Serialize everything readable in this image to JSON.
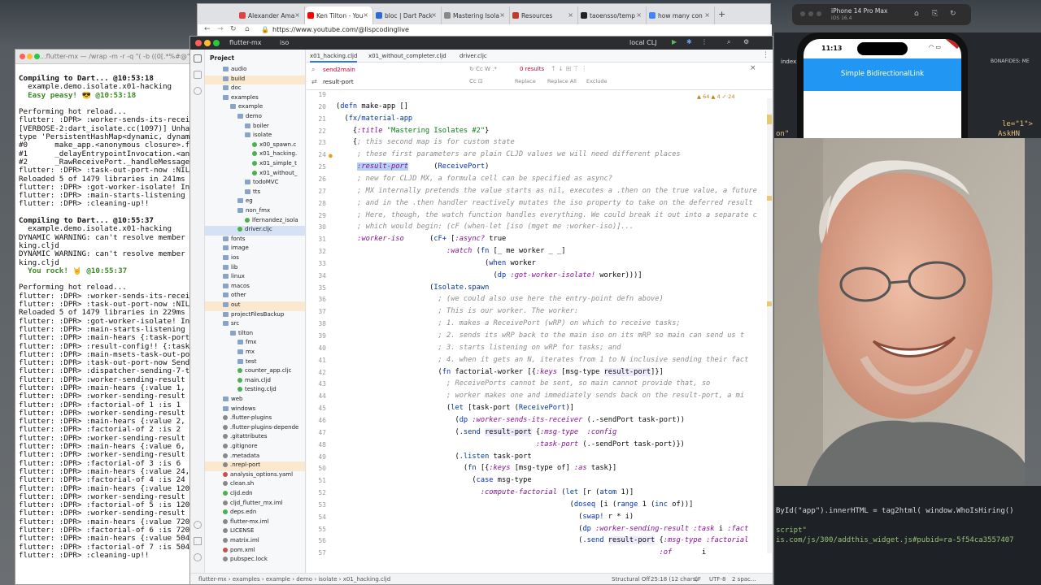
{
  "terminal": {
    "title": "...flutter-mx — /wrap -m -r -q \"( -b ((0[.*%#@\": /usr/local/Ca",
    "lines": [
      {
        "t": "Compiling to Dart... @10:53:18",
        "c": "b"
      },
      {
        "t": "  example.demo.isolate.x01-hacking",
        "c": ""
      },
      {
        "t": "  Easy peasy! 😎 @10:53:18",
        "c": "g"
      },
      {
        "t": "",
        "c": "sp"
      },
      {
        "t": "Performing hot reload...",
        "c": ""
      },
      {
        "t": "flutter: :DPR> :worker-sends-its-receive",
        "c": ""
      },
      {
        "t": "[VERBOSE-2:dart_isolate.cc(1097)] Unhand",
        "c": ""
      },
      {
        "t": "type 'PersistentHashMap<dynamic, dynamic",
        "c": ""
      },
      {
        "t": "#0      make_app.<anonymous closure>.fac",
        "c": ""
      },
      {
        "t": "#1      _delayEntrypointInvocation.<anon",
        "c": ""
      },
      {
        "t": "#2      _RawReceivePort._handleMessage (",
        "c": ""
      },
      {
        "t": "flutter: :DPR> :task-out-port-now :NIL",
        "c": ""
      },
      {
        "t": "Reloaded 5 of 1479 libraries in 241ms (c",
        "c": ""
      },
      {
        "t": "flutter: :DPR> :got-worker-isolate! Inst",
        "c": ""
      },
      {
        "t": "flutter: :DPR> :main-starts-listening",
        "c": ""
      },
      {
        "t": "flutter: :DPR> :cleaning-up!!",
        "c": ""
      },
      {
        "t": "",
        "c": "sp"
      },
      {
        "t": "Compiling to Dart... @10:55:37",
        "c": "b"
      },
      {
        "t": "  example.demo.isolate.x01-hacking",
        "c": ""
      },
      {
        "t": "DYNAMIC WARNING: can't resolve member se",
        "c": ""
      },
      {
        "t": "king.cljd",
        "c": ""
      },
      {
        "t": "DYNAMIC WARNING: can't resolve member se",
        "c": ""
      },
      {
        "t": "king.cljd",
        "c": ""
      },
      {
        "t": "  You rock! 🤘 @10:55:37",
        "c": "g"
      },
      {
        "t": "",
        "c": "sp"
      },
      {
        "t": "Performing hot reload...",
        "c": ""
      },
      {
        "t": "flutter: :DPR> :worker-sends-its-receive",
        "c": ""
      },
      {
        "t": "flutter: :DPR> :task-out-port-now :NIL",
        "c": ""
      },
      {
        "t": "Reloaded 5 of 1479 libraries in 229ms (c",
        "c": ""
      },
      {
        "t": "flutter: :DPR> :got-worker-isolate! Inst",
        "c": ""
      },
      {
        "t": "flutter: :DPR> :main-starts-listening",
        "c": ""
      },
      {
        "t": "flutter: :DPR> :main-hears {:task-port S",
        "c": ""
      },
      {
        "t": "flutter: :DPR> :result-config!! {:task-p",
        "c": ""
      },
      {
        "t": "flutter: :DPR> :main-msets-task-out-port",
        "c": ""
      },
      {
        "t": "flutter: :DPR> :task-out-port-now SendPo",
        "c": ""
      },
      {
        "t": "flutter: :DPR> :dispatcher-sending-7-to-",
        "c": ""
      },
      {
        "t": "flutter: :DPR> :worker-sending-result :t",
        "c": ""
      },
      {
        "t": "flutter: :DPR> :main-hears {:value 1, :m",
        "c": ""
      },
      {
        "t": "flutter: :DPR> :worker-sending-result :t",
        "c": ""
      },
      {
        "t": "flutter: :DPR> :factorial-of 1 :is 1",
        "c": ""
      },
      {
        "t": "flutter: :DPR> :worker-sending-result :t",
        "c": ""
      },
      {
        "t": "flutter: :DPR> :main-hears {:value 2, :m",
        "c": ""
      },
      {
        "t": "flutter: :DPR> :factorial-of 2 :is 2",
        "c": ""
      },
      {
        "t": "flutter: :DPR> :worker-sending-result :t",
        "c": ""
      },
      {
        "t": "flutter: :DPR> :main-hears {:value 6, :m",
        "c": ""
      },
      {
        "t": "flutter: :DPR> :worker-sending-result :t",
        "c": ""
      },
      {
        "t": "flutter: :DPR> :factorial-of 3 :is 6",
        "c": ""
      },
      {
        "t": "flutter: :DPR> :main-hears {:value 24, :",
        "c": ""
      },
      {
        "t": "flutter: :DPR> :factorial-of 4 :is 24",
        "c": ""
      },
      {
        "t": "flutter: :DPR> :main-hears {:value 120,",
        "c": ""
      },
      {
        "t": "flutter: :DPR> :worker-sending-result :t",
        "c": ""
      },
      {
        "t": "flutter: :DPR> :factorial-of 5 :is 120",
        "c": ""
      },
      {
        "t": "flutter: :DPR> :worker-sending-result :t",
        "c": ""
      },
      {
        "t": "flutter: :DPR> :main-hears {:value 720,",
        "c": ""
      },
      {
        "t": "flutter: :DPR> :factorial-of 6 :is 720",
        "c": ""
      },
      {
        "t": "flutter: :DPR> :main-hears {:value 5040,",
        "c": ""
      },
      {
        "t": "flutter: :DPR> :factorial-of 7 :is 5040",
        "c": ""
      },
      {
        "t": "flutter: :DPR> :cleaning-up!!",
        "c": ""
      },
      {
        "t": "",
        "c": "sp"
      }
    ]
  },
  "browser": {
    "tabs": [
      "Alexander Ama",
      "Ken Tilton - You",
      "bloc | Dart Pack",
      "Mastering Isola",
      "Resources",
      "taoensso/temp",
      "how many con"
    ],
    "url": "https://www.youtube.com/@lispcodinglive"
  },
  "ide": {
    "title": "flutter-mx",
    "branch": "iso",
    "run_config": "local CLJ",
    "project_label": "Project",
    "tree": [
      {
        "label": "audio",
        "indent": 2,
        "kind": "folder"
      },
      {
        "label": "build",
        "indent": 2,
        "kind": "folder",
        "hl": "orange"
      },
      {
        "label": "doc",
        "indent": 2,
        "kind": "folder"
      },
      {
        "label": "examples",
        "indent": 2,
        "kind": "folder"
      },
      {
        "label": "example",
        "indent": 3,
        "kind": "folder"
      },
      {
        "label": "demo",
        "indent": 4,
        "kind": "folder"
      },
      {
        "label": "boiler",
        "indent": 5,
        "kind": "folder"
      },
      {
        "label": "isolate",
        "indent": 5,
        "kind": "folder"
      },
      {
        "label": "x00_spawn.c",
        "indent": 6,
        "kind": "clj"
      },
      {
        "label": "x01_hacking.",
        "indent": 6,
        "kind": "clj"
      },
      {
        "label": "x01_simple_t",
        "indent": 6,
        "kind": "clj"
      },
      {
        "label": "x01_without_",
        "indent": 6,
        "kind": "clj"
      },
      {
        "label": "todoMVC",
        "indent": 5,
        "kind": "folder"
      },
      {
        "label": "tts",
        "indent": 5,
        "kind": "folder"
      },
      {
        "label": "eg",
        "indent": 4,
        "kind": "folder"
      },
      {
        "label": "non_fmx",
        "indent": 4,
        "kind": "folder"
      },
      {
        "label": "lfernandez_isola",
        "indent": 5,
        "kind": "clj"
      },
      {
        "label": "driver.cljc",
        "indent": 4,
        "kind": "clj",
        "sel": true
      },
      {
        "label": "fonts",
        "indent": 2,
        "kind": "folder"
      },
      {
        "label": "image",
        "indent": 2,
        "kind": "folder"
      },
      {
        "label": "ios",
        "indent": 2,
        "kind": "folder"
      },
      {
        "label": "lib",
        "indent": 2,
        "kind": "folder"
      },
      {
        "label": "linux",
        "indent": 2,
        "kind": "folder"
      },
      {
        "label": "macos",
        "indent": 2,
        "kind": "folder"
      },
      {
        "label": "other",
        "indent": 2,
        "kind": "folder"
      },
      {
        "label": "out",
        "indent": 2,
        "kind": "folder",
        "hl": "orange"
      },
      {
        "label": "projectFilesBackup",
        "indent": 2,
        "kind": "folder"
      },
      {
        "label": "src",
        "indent": 2,
        "kind": "folder"
      },
      {
        "label": "tilton",
        "indent": 3,
        "kind": "folder"
      },
      {
        "label": "fmx",
        "indent": 4,
        "kind": "folder"
      },
      {
        "label": "mx",
        "indent": 4,
        "kind": "folder"
      },
      {
        "label": "test",
        "indent": 4,
        "kind": "folder"
      },
      {
        "label": "counter_app.cljc",
        "indent": 4,
        "kind": "clj"
      },
      {
        "label": "main.cljd",
        "indent": 4,
        "kind": "clj"
      },
      {
        "label": "testing.cljd",
        "indent": 4,
        "kind": "clj"
      },
      {
        "label": "web",
        "indent": 2,
        "kind": "folder"
      },
      {
        "label": "windows",
        "indent": 2,
        "kind": "folder"
      },
      {
        "label": ".flutter-plugins",
        "indent": 2,
        "kind": "gray"
      },
      {
        "label": ".flutter-plugins-depende",
        "indent": 2,
        "kind": "gray"
      },
      {
        "label": ".gitattributes",
        "indent": 2,
        "kind": "gray"
      },
      {
        "label": ".gitignore",
        "indent": 2,
        "kind": "gray"
      },
      {
        "label": ".metadata",
        "indent": 2,
        "kind": "gray"
      },
      {
        "label": ".nrepl-port",
        "indent": 2,
        "kind": "gray",
        "hl": "orange"
      },
      {
        "label": "analysis_options.yaml",
        "indent": 2,
        "kind": "red"
      },
      {
        "label": "clean.sh",
        "indent": 2,
        "kind": "gray"
      },
      {
        "label": "cljd.edn",
        "indent": 2,
        "kind": "clj"
      },
      {
        "label": "cljd_flutter_mx.iml",
        "indent": 2,
        "kind": "gray"
      },
      {
        "label": "deps.edn",
        "indent": 2,
        "kind": "clj"
      },
      {
        "label": "flutter-mx.iml",
        "indent": 2,
        "kind": "gray"
      },
      {
        "label": "LICENSE",
        "indent": 2,
        "kind": "gray"
      },
      {
        "label": "matrix.iml",
        "indent": 2,
        "kind": "gray"
      },
      {
        "label": "pom.xml",
        "indent": 2,
        "kind": "red"
      },
      {
        "label": "pubspec.lock",
        "indent": 2,
        "kind": "gray"
      }
    ],
    "editor_tabs": [
      "x01_hacking.cljd",
      "x01_without_completer.cljd",
      "driver.cljc"
    ],
    "find": {
      "query": "send2main",
      "results": "0 results",
      "replace": "result-port",
      "btn_replace": "Replace",
      "btn_replace_all": "Replace All",
      "btn_exclude": "Exclude"
    },
    "inspections": "▲ 64  ▲ 4  ✓ 24",
    "code_lines": [
      {
        "n": "19",
        "h": ""
      },
      {
        "n": "20",
        "h": "(<span class=fn>defn</span> make-app []"
      },
      {
        "n": "21",
        "h": "  (<span class=fn>fx/material-app</span>"
      },
      {
        "n": "22",
        "h": "    {<span class=kw>:title</span> <span class=str>\"Mastering Isolates #2\"</span>}"
      },
      {
        "n": "23",
        "h": "    {<span class=cm>; this second map is for custom state</span>"
      },
      {
        "n": "24",
        "h": "     <span class=cm>; these first parameters are plain CLJD values we will need different places</span>"
      },
      {
        "n": "25",
        "h": "     <span class='kw hl'>:result-port</span>      (<span class=fn>ReceivePort</span>)"
      },
      {
        "n": "26",
        "h": "     <span class=cm>; new for CLJD MX, a formula cell can be specified as async?</span>"
      },
      {
        "n": "27",
        "h": "     <span class=cm>; MX internally pretends the value starts as nil, executes a .then on the true value, a future</span>"
      },
      {
        "n": "28",
        "h": "     <span class=cm>; and in the .then handler reactively mutates the iso property to take on the deferred result</span>"
      },
      {
        "n": "29",
        "h": "     <span class=cm>; Here, though, the watch function handles everything. We could break it out into a separate c</span>"
      },
      {
        "n": "30",
        "h": "     <span class=cm>; which would begin: (cF (when-let [iso (mget me :worker-iso)]...</span>"
      },
      {
        "n": "31",
        "h": "     <span class=kw>:worker-iso</span>      (<span class=fn>cF+</span> [<span class=kw>:async?</span> true"
      },
      {
        "n": "32",
        "h": "                          <span class=kw>:watch</span> (<span class=fn>fn</span> [_ me worker _ _]"
      },
      {
        "n": "33",
        "h": "                                   (<span class=fn>when</span> worker"
      },
      {
        "n": "34",
        "h": "                                     (<span class=fn>dp</span> <span class=kw>:got-worker-isolate!</span> worker)))]"
      },
      {
        "n": "35",
        "h": "                      (<span class=fn>Isolate.spawn</span>"
      },
      {
        "n": "36",
        "h": "                        <span class=cm>; (we could also use here the entry-point defn above)</span>"
      },
      {
        "n": "37",
        "h": "                        <span class=cm>; This is our worker. The worker:</span>"
      },
      {
        "n": "38",
        "h": "                        <span class=cm>; 1. makes a ReceivePort (wRP) on which to receive tasks;</span>"
      },
      {
        "n": "39",
        "h": "                        <span class=cm>; 2. sends its wRP back to the main iso on its mRP so main can send us t</span>"
      },
      {
        "n": "40",
        "h": "                        <span class=cm>; 3. starts listening on wRP for tasks; and</span>"
      },
      {
        "n": "41",
        "h": "                        <span class=cm>; 4. when it gets an N, iterates from 1 to N inclusive sending their fact</span>"
      },
      {
        "n": "42",
        "h": "                        (<span class=fn>fn</span> factorial-worker [{<span class=kw>:keys</span> [msg-type <span class=bg>result-port</span>]}]"
      },
      {
        "n": "43",
        "h": "                          <span class=cm>; ReceivePorts cannot be sent, so main cannot provide that, so</span>"
      },
      {
        "n": "44",
        "h": "                          <span class=cm>; worker makes one and immediately sends back on the result-port, a mi</span>"
      },
      {
        "n": "45",
        "h": "                          (<span class=fn>let</span> [task-port (<span class=fn>ReceivePort</span>)]"
      },
      {
        "n": "46",
        "h": "                            (<span class=fn>dp</span> <span class=kw>:worker-sends-its-receiver</span> (.-sendPort task-port))"
      },
      {
        "n": "47",
        "h": "                            (<span class=fn>.send</span> <span class=bg>result-port</span> {<span class=kw>:msg-type</span>  <span class=kw>:config</span>"
      },
      {
        "n": "48",
        "h": "                                               <span class=kw>:task-port</span> (.-sendPort task-port)})"
      },
      {
        "n": "49",
        "h": "                            (<span class=fn>.listen</span> task-port"
      },
      {
        "n": "50",
        "h": "                              (<span class=fn>fn</span> [{<span class=kw>:keys</span> [msg-type of] <span class=kw>:as</span> task}]"
      },
      {
        "n": "51",
        "h": "                                (<span class=fn>case</span> msg-type"
      },
      {
        "n": "52",
        "h": "                                  <span class=kw>:compute-factorial</span> (<span class=fn>let</span> [r (<span class=fn>atom</span> 1)]"
      },
      {
        "n": "53",
        "h": "                                                       (<span class=fn>doseq</span> [i (<span class=fn>range</span> 1 (<span class=fn>inc</span> of))]"
      },
      {
        "n": "54",
        "h": "                                                         (<span class=fn>swap!</span> r * i)"
      },
      {
        "n": "55",
        "h": "                                                         (<span class=fn>dp</span> <span class=kw>:worker-sending-result</span> <span class=kw>:task</span> i <span class=kw>:fact</span>"
      },
      {
        "n": "56",
        "h": "                                                         (<span class=fn>.send</span> <span class=bg>result-port</span> {<span class=kw>:msg-type</span> <span class=kw>:factorial</span>"
      },
      {
        "n": "57",
        "h": "                                                                            <span class=kw>:of</span>       i"
      }
    ],
    "status": {
      "breadcrumb": [
        "flutter-mx",
        "examples",
        "example",
        "demo",
        "isolate",
        "x01_hacking.cljd"
      ],
      "structural": "Structural Off",
      "position": "25:18 (12 chars)",
      "lf": "LF",
      "encoding": "UTF-8",
      "indent": "2 spac..."
    }
  },
  "phone": {
    "sim_label": "iPhone 14 Pro Max",
    "sim_version": "iOS 16.4",
    "time": "11:13",
    "app_title": "Simple BidirectionalLink"
  },
  "right_panel": {
    "index_tab": "index.h",
    "bonafides_tab": "BONAFIDES: ME",
    "frag1": "le=\"1\">",
    "frag2": "AskHN Who'",
    "frag3": "on\"",
    "edit_line1": "ById(\"app\").innerHTML = tag2html( window.WhoIsHiring()",
    "edit_line2": "script\"",
    "edit_line3": "is.com/js/300/addthis_widget.js#pubid=ra-5f54ca3557407"
  }
}
